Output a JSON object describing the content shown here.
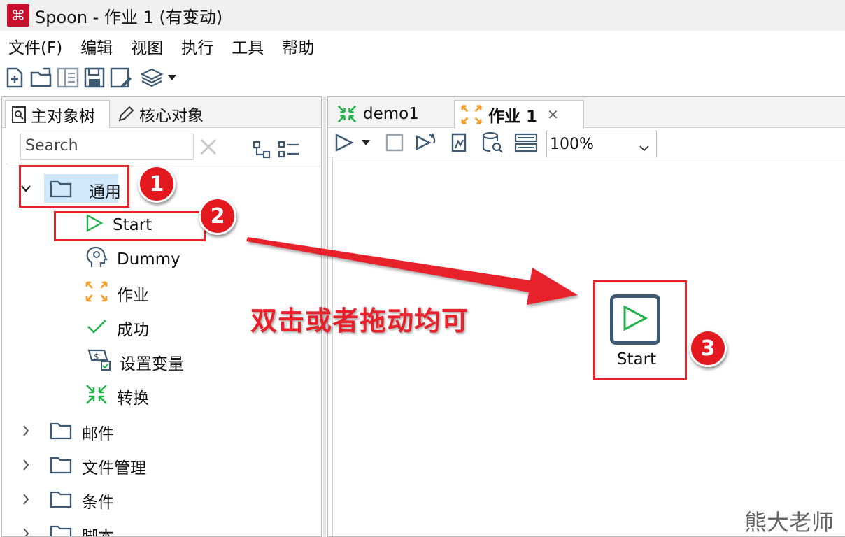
{
  "window": {
    "title": "Spoon - 作业 1 (有变动)"
  },
  "menu": [
    "文件(F)",
    "编辑",
    "视图",
    "执行",
    "工具",
    "帮助"
  ],
  "left_panel": {
    "tabs": [
      "主对象树",
      "核心对象"
    ],
    "search_placeholder": "Search",
    "tree": {
      "expanded_folder": "通用",
      "items": [
        "Start",
        "Dummy",
        "作业",
        "成功",
        "设置变量",
        "转换"
      ],
      "collapsed_folders": [
        "邮件",
        "文件管理",
        "条件",
        "脚本"
      ]
    }
  },
  "editor": {
    "tabs": [
      {
        "label": "demo1",
        "icon": "transformation-icon"
      },
      {
        "label": "作业 1",
        "icon": "job-icon",
        "active": true
      }
    ],
    "zoom": "100%"
  },
  "canvas": {
    "node_label": "Start",
    "annotation": "双击或者拖动均可"
  },
  "badges": [
    "1",
    "2",
    "3"
  ],
  "watermark": "熊大老师",
  "colors": {
    "annotation_red": "#e8202a",
    "start_green": "#22b14c",
    "node_border": "#3e5a73",
    "selection": "#cfe8fb"
  }
}
